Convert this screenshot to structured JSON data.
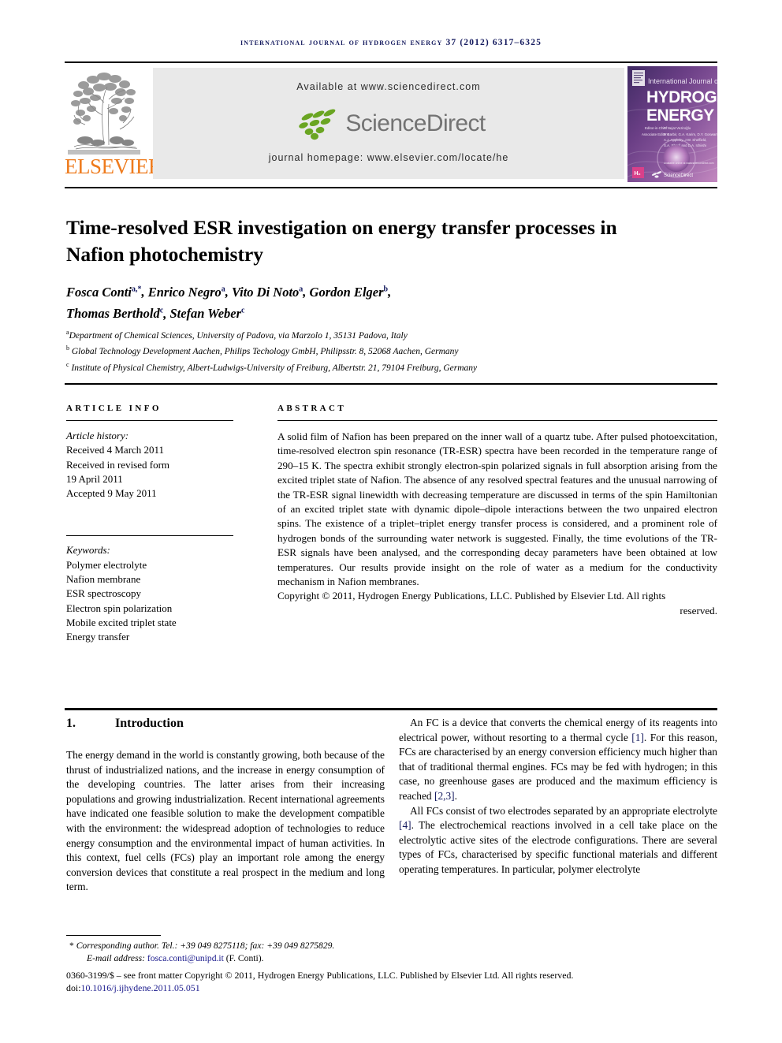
{
  "running_head": "international journal of hydrogen energy 37 (2012) 6317–6325",
  "masthead": {
    "elsevier_wordmark": "ELSEVIER",
    "available_at": "Available at www.sciencedirect.com",
    "sciencedirect_logo_text": "ScienceDirect",
    "journal_homepage": "journal homepage: www.elsevier.com/locate/he",
    "cover": {
      "line1": "International Journal of",
      "line2": "HYDROGEN",
      "line3": "ENERGY",
      "editor_label": "Editor-in-Chief",
      "editor_name": "T. Nejat Veziroğlu",
      "assoc_label": "Associate Editors",
      "assoc_1": "F. Barbir, G.A. Karim, D.Y. Goswami,",
      "assoc_2": "A.J. Appleby, J.W. Sheffield,",
      "assoc_3": "S.A. Sherif and D.A. Ichiishi",
      "badge": "IAHE",
      "sd_mark": "ScienceDirect"
    }
  },
  "title": "Time-resolved ESR investigation on energy transfer processes in Nafion photochemistry",
  "authors": [
    {
      "name": "Fosca Conti",
      "sup": "a,*"
    },
    {
      "name": "Enrico Negro",
      "sup": "a"
    },
    {
      "name": "Vito Di Noto",
      "sup": "a"
    },
    {
      "name": "Gordon Elger",
      "sup": "b"
    },
    {
      "name": "Thomas Berthold",
      "sup": "c"
    },
    {
      "name": "Stefan Weber",
      "sup": "c"
    }
  ],
  "affiliations": [
    {
      "mark": "a",
      "text": "Department of Chemical Sciences, University of Padova, via Marzolo 1, 35131 Padova, Italy"
    },
    {
      "mark": "b",
      "text": "Global Technology Development Aachen, Philips Techology GmbH, Philipsstr. 8, 52068 Aachen, Germany"
    },
    {
      "mark": "c",
      "text": "Institute of Physical Chemistry, Albert-Ludwigs-University of Freiburg, Albertstr. 21, 79104 Freiburg, Germany"
    }
  ],
  "article_info": {
    "heading": "ARTICLE INFO",
    "history_label": "Article history:",
    "history": [
      "Received 4 March 2011",
      "Received in revised form",
      "19 April 2011",
      "Accepted 9 May 2011"
    ],
    "keywords_label": "Keywords:",
    "keywords": [
      "Polymer electrolyte",
      "Nafion membrane",
      "ESR spectroscopy",
      "Electron spin polarization",
      "Mobile excited triplet state",
      "Energy transfer"
    ]
  },
  "abstract": {
    "heading": "ABSTRACT",
    "text": "A solid film of Nafion has been prepared on the inner wall of a quartz tube. After pulsed photoexcitation, time-resolved electron spin resonance (TR-ESR) spectra have been recorded in the temperature range of 290–15 K. The spectra exhibit strongly electron-spin polarized signals in full absorption arising from the excited triplet state of Nafion. The absence of any resolved spectral features and the unusual narrowing of the TR-ESR signal linewidth with decreasing temperature are discussed in terms of the spin Hamiltonian of an excited triplet state with dynamic dipole–dipole interactions between the two unpaired electron spins. The existence of a triplet–triplet energy transfer process is considered, and a prominent role of hydrogen bonds of the surrounding water network is suggested. Finally, the time evolutions of the TR-ESR signals have been analysed, and the corresponding decay parameters have been obtained at low temperatures. Our results provide insight on the role of water as a medium for the conductivity mechanism in Nafion membranes.",
    "copyright_main": "Copyright © 2011, Hydrogen Energy Publications, LLC. Published by Elsevier Ltd. All rights",
    "copyright_last": "reserved."
  },
  "body": {
    "section_number": "1.",
    "section_title": "Introduction",
    "left_paragraphs": [
      "The energy demand in the world is constantly growing, both because of the thrust of industrialized nations, and the increase in energy consumption of the developing countries. The latter arises from their increasing populations and growing industrialization. Recent international agreements have indicated one feasible solution to make the development compatible with the environment: the widespread adoption of technologies to reduce energy consumption and the environmental impact of human activities. In this context, fuel cells (FCs) play an important role among the energy conversion devices that constitute a real prospect in the medium and long term."
    ],
    "right_paragraph_1_pre": "An FC is a device that converts the chemical energy of its reagents into electrical power, without resorting to a thermal cycle ",
    "right_paragraph_1_ref1": "[1]",
    "right_paragraph_1_mid": ". For this reason, FCs are characterised by an energy conversion efficiency much higher than that of traditional thermal engines. FCs may be fed with hydrogen; in this case, no greenhouse gases are produced and the maximum efficiency is reached ",
    "right_paragraph_1_ref2": "[2,3]",
    "right_paragraph_1_post": ".",
    "right_paragraph_2_pre": "All FCs consist of two electrodes separated by an appropriate electrolyte ",
    "right_paragraph_2_ref": "[4]",
    "right_paragraph_2_post": ". The electrochemical reactions involved in a cell take place on the electrolytic active sites of the electrode configurations. There are several types of FCs, characterised by specific functional materials and different operating temperatures. In particular, polymer electrolyte"
  },
  "footnotes": {
    "corresponding_marker": "*",
    "corresponding": "Corresponding author. Tel.: +39 049 8275118; fax: +39 049 8275829.",
    "email_label": "E-mail address:",
    "email": "fosca.conti@unipd.it",
    "email_suffix": "(F. Conti).",
    "issn_line": "0360-3199/$ – see front matter Copyright © 2011, Hydrogen Energy Publications, LLC. Published by Elsevier Ltd. All rights reserved.",
    "doi_label": "doi:",
    "doi": "10.1016/j.ijhydene.2011.05.051"
  },
  "colors": {
    "running_head": "#141a5e",
    "elsevier_orange": "#ee7b1d",
    "sciencedirect_green": "#6aa522",
    "sciencedirect_gray": "#737373",
    "banner_bg": "#e9e9e9",
    "link_blue": "#1a1a8c"
  }
}
